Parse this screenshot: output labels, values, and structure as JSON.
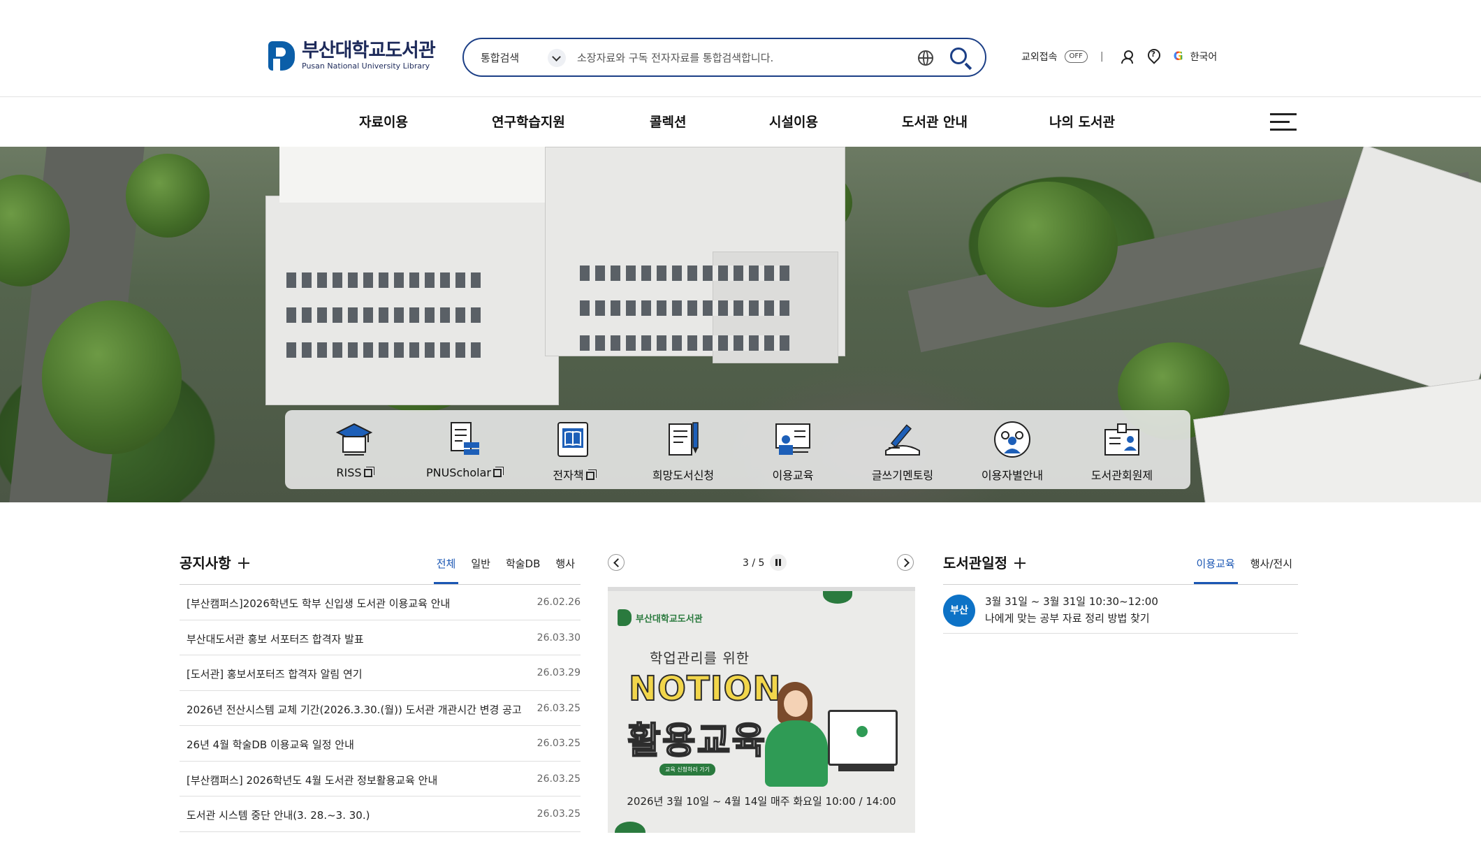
{
  "header": {
    "logo_ko": "부산대학교도서관",
    "logo_en": "Pusan National University Library",
    "search": {
      "scope": "통합검색",
      "placeholder": "소장자료와 구독 전자자료를 통합검색합니다."
    },
    "util": {
      "offcampus_label": "교외접속",
      "offcampus_state": "OFF",
      "language": "한국어"
    }
  },
  "gnb": {
    "items": [
      "자료이용",
      "연구학습지원",
      "콜렉션",
      "시설이용",
      "도서관 안내",
      "나의 도서관"
    ]
  },
  "quick_links": [
    {
      "label": "RISS",
      "icon": "graduation-cap-icon",
      "external": true
    },
    {
      "label": "PNUScholar",
      "icon": "document-stack-icon",
      "external": true
    },
    {
      "label": "전자책",
      "icon": "ebook-tablet-icon",
      "external": true
    },
    {
      "label": "희망도서신청",
      "icon": "notebook-pen-icon",
      "external": false
    },
    {
      "label": "이용교육",
      "icon": "presentation-board-icon",
      "external": false
    },
    {
      "label": "글쓰기멘토링",
      "icon": "writing-pen-icon",
      "external": false
    },
    {
      "label": "이용자별안내",
      "icon": "user-group-icon",
      "external": false
    },
    {
      "label": "도서관회원제",
      "icon": "member-card-icon",
      "external": false
    }
  ],
  "notice": {
    "title": "공지사항",
    "tabs": [
      "전체",
      "일반",
      "학술DB",
      "행사"
    ],
    "active_tab": "전체",
    "items": [
      {
        "title": "[부산캠퍼스]2026학년도 학부 신입생 도서관 이용교육 안내",
        "date": "26.02.26"
      },
      {
        "title": "부산대도서관 홍보 서포터즈 합격자 발표",
        "date": "26.03.30"
      },
      {
        "title": "[도서관] 홍보서포터즈 합격자 알림 연기",
        "date": "26.03.29"
      },
      {
        "title": "2026년 전산시스템 교체 기간(2026.3.30.(월)) 도서관 개관시간 변경 공고",
        "date": "26.03.25"
      },
      {
        "title": "26년 4월 학술DB 이용교육 일정 안내",
        "date": "26.03.25"
      },
      {
        "title": "[부산캠퍼스] 2026학년도 4월 도서관 정보활용교육 안내",
        "date": "26.03.25"
      },
      {
        "title": "도서관 시스템 중단 안내(3. 28.~3. 30.)",
        "date": "26.03.25"
      }
    ]
  },
  "banner": {
    "pager": "3 / 5",
    "poster": {
      "logo": "부산대학교도서관",
      "subtitle": "학업관리를 위한",
      "headline1": "NOTION",
      "headline2": "활용교육",
      "pill": "교육 신청하러 가기",
      "date": "2026년 3월 10일 ~ 4월 14일 매주 화요일 10:00 / 14:00"
    }
  },
  "schedule": {
    "title": "도서관일정",
    "tabs": [
      "이용교육",
      "행사/전시"
    ],
    "active_tab": "이용교육",
    "items": [
      {
        "campus": "부산",
        "when": "3월 31일 ~ 3월 31일   10:30~12:00",
        "what": "나에게 맞는 공부 자료 정리 방법 찾기"
      }
    ]
  },
  "colors": {
    "brand_navy": "#1c3f86",
    "accent_blue": "#1a56b3",
    "badge_blue": "#0d72c6"
  }
}
